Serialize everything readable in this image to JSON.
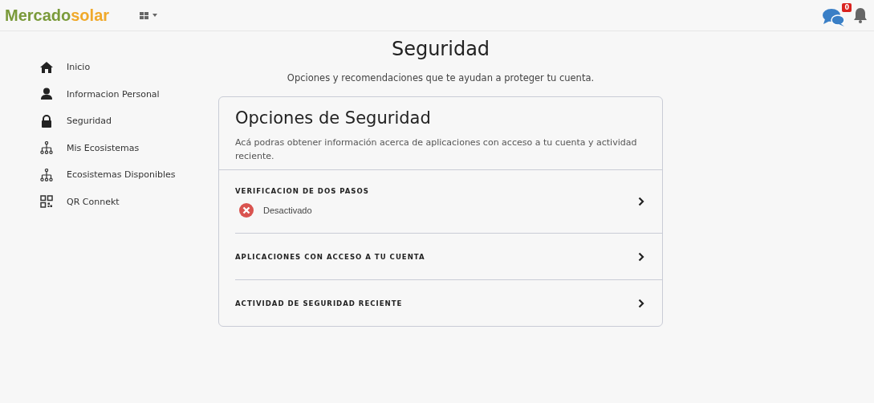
{
  "header": {
    "logo": {
      "first": "Mercado",
      "second": "solar"
    },
    "chat_badge": "0"
  },
  "sidebar": {
    "items": [
      {
        "label": "Inicio",
        "kind": "home"
      },
      {
        "label": "Informacion Personal",
        "kind": "profile"
      },
      {
        "label": "Seguridad",
        "kind": "security"
      },
      {
        "label": "Mis Ecosistemas",
        "kind": "ecosystem"
      },
      {
        "label": "Ecosistemas Disponibles",
        "kind": "ecosystem"
      },
      {
        "label": "QR Connekt",
        "kind": "qr"
      }
    ]
  },
  "page": {
    "title": "Seguridad",
    "subtitle": "Opciones y recomendaciones que te ayudan a proteger tu cuenta."
  },
  "card": {
    "title": "Opciones de Seguridad",
    "description": "Acá podras obtener información acerca de aplicaciones con acceso a tu cuenta y actividad reciente.",
    "options": [
      {
        "label": "VERIFICACION DE DOS PASOS",
        "status": {
          "text": "Desactivado",
          "enabled": false
        }
      },
      {
        "label": "APLICACIONES CON ACCESO A TU CUENTA"
      },
      {
        "label": "ACTIVIDAD DE SEGURIDAD RECIENTE"
      }
    ]
  }
}
